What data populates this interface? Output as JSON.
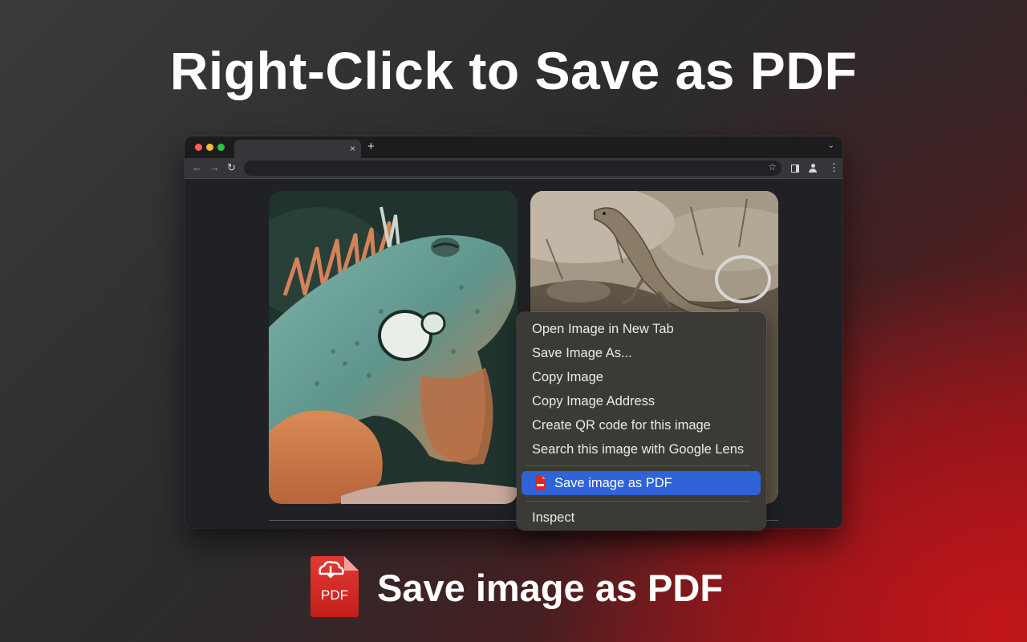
{
  "headline": "Right-Click to Save as PDF",
  "browser": {
    "tab_close": "×",
    "new_tab": "+",
    "tab_menu": "⌄",
    "nav_back": "←",
    "nav_forward": "→",
    "nav_reload": "↻",
    "bookmark": "☆",
    "menu": "⋮"
  },
  "context_menu": {
    "items": [
      "Open Image in New Tab",
      "Save Image As...",
      "Copy Image",
      "Copy Image Address",
      "Create QR code for this image",
      "Search this image with Google Lens"
    ],
    "highlighted": "Save image as PDF",
    "inspect": "Inspect"
  },
  "footer": {
    "icon_label": "PDF",
    "title": "Save image as PDF"
  },
  "colors": {
    "highlight": "#2f63d6",
    "pdf_red": "#d42a26",
    "accent_red": "#c0151a"
  }
}
